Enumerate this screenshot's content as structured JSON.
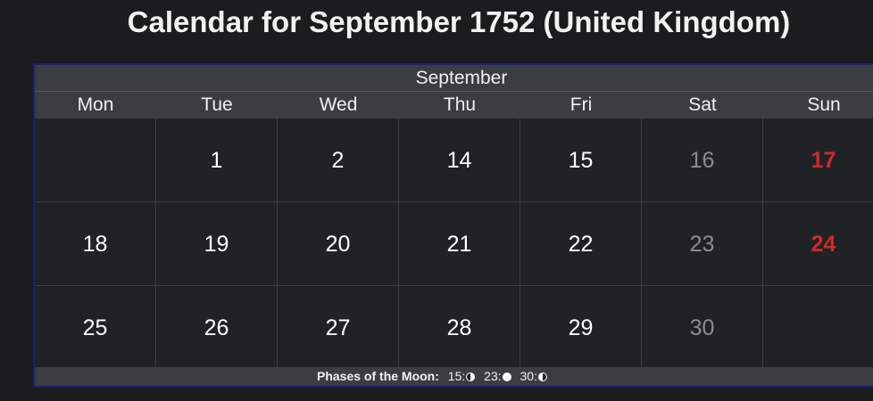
{
  "page": {
    "title": "Calendar for September 1752 (United Kingdom)"
  },
  "calendar": {
    "month": "September",
    "weekdays": [
      "Mon",
      "Tue",
      "Wed",
      "Thu",
      "Fri",
      "Sat",
      "Sun"
    ],
    "weeks": [
      [
        "",
        "1",
        "2",
        "14",
        "15",
        "16",
        "17"
      ],
      [
        "18",
        "19",
        "20",
        "21",
        "22",
        "23",
        "24"
      ],
      [
        "25",
        "26",
        "27",
        "28",
        "29",
        "30",
        ""
      ]
    ]
  },
  "moon_phases": {
    "label": "Phases of the Moon:",
    "phases": [
      {
        "day": "15:",
        "icon": "first-quarter-moon-icon"
      },
      {
        "day": "23:",
        "icon": "full-moon-icon"
      },
      {
        "day": "30:",
        "icon": "last-quarter-moon-icon"
      }
    ]
  },
  "colors": {
    "background": "#1b1c1e",
    "header": "#3a3d41",
    "border": "#1a1f7a",
    "sunday": "#d0292c",
    "saturday": "#8a8d90"
  }
}
